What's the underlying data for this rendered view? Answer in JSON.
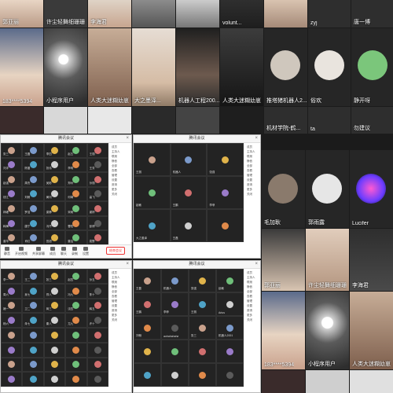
{
  "top_grid": {
    "row1": [
      "郭亚丽",
      "许尘轻舞细珊珊",
      "李海君",
      "",
      "",
      "volunt...",
      "",
      "zyj",
      "唐一博"
    ],
    "row2": [
      "183****5394",
      "小程序用户",
      "人类大迷糊幼崽",
      "大之墨泽...",
      "机器人工程200...",
      "人类大迷糊幼崽",
      "推塔猪机器人2...",
      "俗欢",
      "静开呀"
    ],
    "row3": [
      "",
      "",
      "",
      "",
      "",
      "机材学院-鹤...",
      "ta",
      "",
      "勿建议"
    ]
  },
  "right_grid": {
    "row4": [
      "毛加耿",
      "郭雨露",
      "Lucifer"
    ],
    "row5": [
      "郭亚丽",
      "许尘轻舞细珊珊",
      "李海君"
    ],
    "row6": [
      "183****5394",
      "小程序用户",
      "人类大迷糊幼崽"
    ]
  },
  "meeting_windows": {
    "title": "腾讯会议",
    "w1_cells": [
      "张三",
      "王磊",
      "李四",
      "赵五",
      "王丽",
      "刘洋",
      "陈晨",
      "张伟",
      "李明",
      "王芳",
      "赵强",
      "周杰",
      "吴彬",
      "郑州",
      "孙丽",
      "钱江",
      "刘畅",
      "黄河",
      "何琳",
      "高飞",
      "林峰",
      "罗浩",
      "梁静",
      "宋雨",
      "谢婷",
      "韩梅",
      "唐宁",
      "冯丹",
      "曹阳",
      "彭博",
      "曾华",
      "肖红",
      "田甜",
      "董洁",
      "袁野"
    ],
    "w1_toolbar": [
      "静音",
      "开启视频",
      "共享屏幕",
      "成员",
      "聊天",
      "录制",
      "设置"
    ],
    "w1_end": "结束会议",
    "w2_cells": [
      "王丽",
      "机器人",
      "张强",
      "赵敏",
      "王鹏",
      "李菲",
      "大之墨泽",
      "王磊"
    ],
    "w3_cells": [
      "李一",
      "王二",
      "张三",
      "赵四",
      "孙五",
      "周六",
      "吴七",
      "郑八",
      "冯九",
      "陈十",
      "褚一",
      "卫二",
      "蒋三",
      "沈四",
      "韩五",
      "杨六",
      "朱七",
      "秦八",
      "尤九",
      "许十"
    ],
    "w4_cells": [
      "王磊",
      "机器人",
      "张强",
      "赵敏",
      "王鹏",
      "李菲",
      "王丽",
      "Arius",
      "刘畅",
      "aohahahaha",
      "张三",
      "机器人2001"
    ],
    "side_items": [
      "成员",
      "主持人",
      "联席",
      "静音",
      "全部",
      "查看",
      "管理",
      "设置",
      "邀请",
      "更多",
      "关闭"
    ]
  },
  "colors": {
    "dark_tile": "#2a2a2a",
    "background": "#1b1b1b",
    "window_bg": "#ffffff",
    "end_red": "#e33333"
  }
}
